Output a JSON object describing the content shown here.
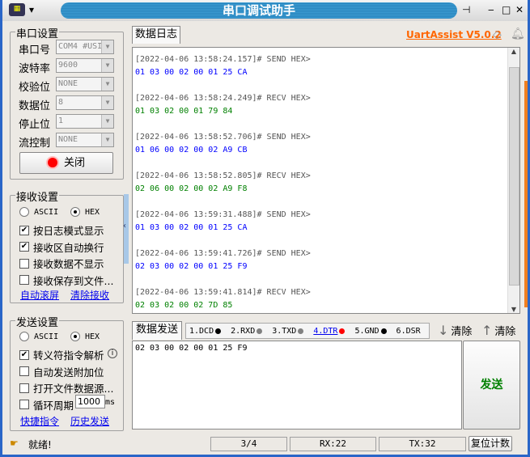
{
  "window": {
    "title": "串口调试助手",
    "pin_icon": "pin-icon",
    "minimize": "‒",
    "maximize": "□",
    "close": "✕"
  },
  "brand": {
    "name": "UartAssist V5.0.2",
    "color": "#ff6600"
  },
  "serial_settings": {
    "legend": "串口设置",
    "fields": [
      {
        "label": "串口号",
        "value": "COM4 #USI"
      },
      {
        "label": "波特率",
        "value": "9600"
      },
      {
        "label": "校验位",
        "value": "NONE"
      },
      {
        "label": "数据位",
        "value": "8"
      },
      {
        "label": "停止位",
        "value": "1"
      },
      {
        "label": "流控制",
        "value": "NONE"
      }
    ],
    "close_button": "关闭"
  },
  "receive_settings": {
    "legend": "接收设置",
    "ascii": "ASCII",
    "hex": "HEX",
    "mode": "HEX",
    "options": [
      {
        "label": "按日志模式显示",
        "checked": true
      },
      {
        "label": "接收区自动换行",
        "checked": true
      },
      {
        "label": "接收数据不显示",
        "checked": false
      },
      {
        "label": "接收保存到文件...",
        "checked": false
      }
    ],
    "links": [
      "自动滚屏",
      "清除接收"
    ]
  },
  "send_settings": {
    "legend": "发送设置",
    "ascii": "ASCII",
    "hex": "HEX",
    "mode": "HEX",
    "options": [
      {
        "label": "转义符指令解析",
        "checked": true
      },
      {
        "label": "自动发送附加位",
        "checked": false
      },
      {
        "label": "打开文件数据源...",
        "checked": false
      },
      {
        "label": "循环周期",
        "checked": false
      }
    ],
    "period": "1000",
    "period_unit": "ms",
    "links": [
      "快捷指令",
      "历史发送"
    ]
  },
  "log": {
    "tab": "数据日志",
    "entries": [
      {
        "header": "[2022-04-06 13:58:24.157]# SEND HEX>",
        "data": "01 03 00 02 00 01 25 CA",
        "type": "send"
      },
      {
        "header": "[2022-04-06 13:58:24.249]# RECV HEX>",
        "data": "01 03 02 00 01 79 84",
        "type": "recv"
      },
      {
        "header": "[2022-04-06 13:58:52.706]# SEND HEX>",
        "data": "01 06 00 02 00 02 A9 CB",
        "type": "send"
      },
      {
        "header": "[2022-04-06 13:58:52.805]# RECV HEX>",
        "data": "02 06 00 02 00 02 A9 F8",
        "type": "recv"
      },
      {
        "header": "[2022-04-06 13:59:31.488]# SEND HEX>",
        "data": "01 03 00 02 00 01 25 CA",
        "type": "send"
      },
      {
        "header": "[2022-04-06 13:59:41.726]# SEND HEX>",
        "data": "02 03 00 02 00 01 25 F9",
        "type": "send"
      },
      {
        "header": "[2022-04-06 13:59:41.814]# RECV HEX>",
        "data": "02 03 02 00 02 7D 85",
        "type": "recv"
      }
    ],
    "colors": {
      "send": "#0000ff",
      "recv": "#008000",
      "header": "#555555"
    }
  },
  "send": {
    "tab": "数据发送",
    "pins": [
      {
        "label": "1.DCD",
        "color": "#000000"
      },
      {
        "label": "2.RXD",
        "color": "#808080"
      },
      {
        "label": "3.TXD",
        "color": "#808080"
      },
      {
        "label": "4.DTR",
        "color": "#ff0000",
        "link": true
      },
      {
        "label": "5.GND",
        "color": "#000000"
      },
      {
        "label": "6.DSR",
        "color": null
      }
    ],
    "clear_recv": "清除",
    "clear_send": "清除",
    "text": "02 03 00 02 00 01 25 F9",
    "button": "发送"
  },
  "status": {
    "text": "就绪!",
    "page": "3/4",
    "rx": "RX:22",
    "tx": "TX:32",
    "reset": "复位计数"
  }
}
